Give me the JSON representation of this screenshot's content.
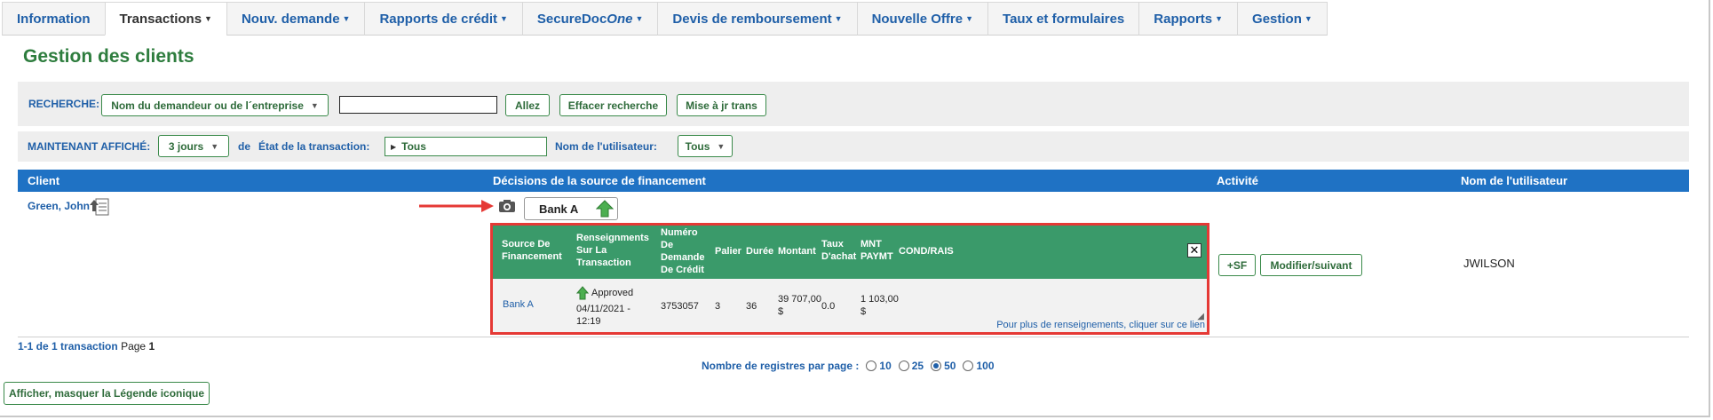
{
  "tabs": [
    {
      "label": "Information",
      "caret": false,
      "active": false
    },
    {
      "label": "Transactions",
      "caret": true,
      "active": true
    },
    {
      "label": "Nouv. demande",
      "caret": true,
      "active": false
    },
    {
      "label": "Rapports de crédit",
      "caret": true,
      "active": false
    },
    {
      "label": "SecureDocOne",
      "caret": true,
      "active": false
    },
    {
      "label": "Devis de remboursement",
      "caret": true,
      "active": false
    },
    {
      "label": "Nouvelle Offre",
      "caret": true,
      "active": false
    },
    {
      "label": "Taux et formulaires",
      "caret": false,
      "active": false
    },
    {
      "label": "Rapports",
      "caret": true,
      "active": false
    },
    {
      "label": "Gestion",
      "caret": true,
      "active": false
    }
  ],
  "tab_securedoc": {
    "prefix": "SecureDoc",
    "suffix": "One"
  },
  "page_title": "Gestion des clients",
  "search": {
    "label": "RECHERCHE:",
    "field_select": "Nom du demandeur ou de l´entreprise",
    "query": "",
    "go_label": "Allez",
    "clear_label": "Effacer recherche",
    "update_label": "Mise à jr trans"
  },
  "filter": {
    "shown_label": "MAINTENANT AFFICHÉ:",
    "days_select": "3 jours",
    "de_label": "de",
    "state_label": "État de la transaction:",
    "state_value": "Tous",
    "user_label": "Nom de l'utilisateur:",
    "user_select": "Tous"
  },
  "table": {
    "headers": {
      "client": "Client",
      "decisions": "Décisions de la source de financement",
      "activity": "Activité",
      "username": "Nom de l'utilisateur"
    },
    "row": {
      "client": "Green, John",
      "lender_button": "Bank A",
      "sf_button": "+SF",
      "modify_button": "Modifier/suivant",
      "username": "JWILSON"
    }
  },
  "popup": {
    "headers": {
      "source": [
        "Source De",
        "Financement"
      ],
      "info": [
        "Renseignments",
        "Sur La",
        "Transaction"
      ],
      "number": [
        "Numéro",
        "De",
        "Demande",
        "De Crédit"
      ],
      "tier": "Palier",
      "term": "Durée",
      "amount": "Montant",
      "rate": [
        "Taux",
        "D'achat"
      ],
      "payment": [
        "MNT",
        "PAYMT"
      ],
      "cond": "COND/RAIS"
    },
    "row": {
      "source": "Bank A",
      "status": "Approved",
      "date": "04/11/2021 -",
      "time": "12:19",
      "number": "3753057",
      "tier": "3",
      "term": "36",
      "amount": "39 707,00",
      "amount_unit": "$",
      "rate": "0.0",
      "payment": "1 103,00",
      "payment_unit": "$"
    },
    "more_link": "Pour plus de renseignements, cliquer sur ce lien",
    "close": "✕"
  },
  "pagination": {
    "range": "1-1 de 1 transaction",
    "page_label": "Page",
    "page_num": "1",
    "per_page_label": "Nombre de registres par page :",
    "options": [
      "10",
      "25",
      "50",
      "100"
    ],
    "selected": "50"
  },
  "legend_button": "Afficher, masquer la Légende iconique",
  "colors": {
    "link_blue": "#1f5fa8",
    "header_blue": "#1f72c4",
    "popup_green": "#3a9a6a",
    "highlight_red": "#e53935",
    "title_green": "#2e7d3e"
  }
}
